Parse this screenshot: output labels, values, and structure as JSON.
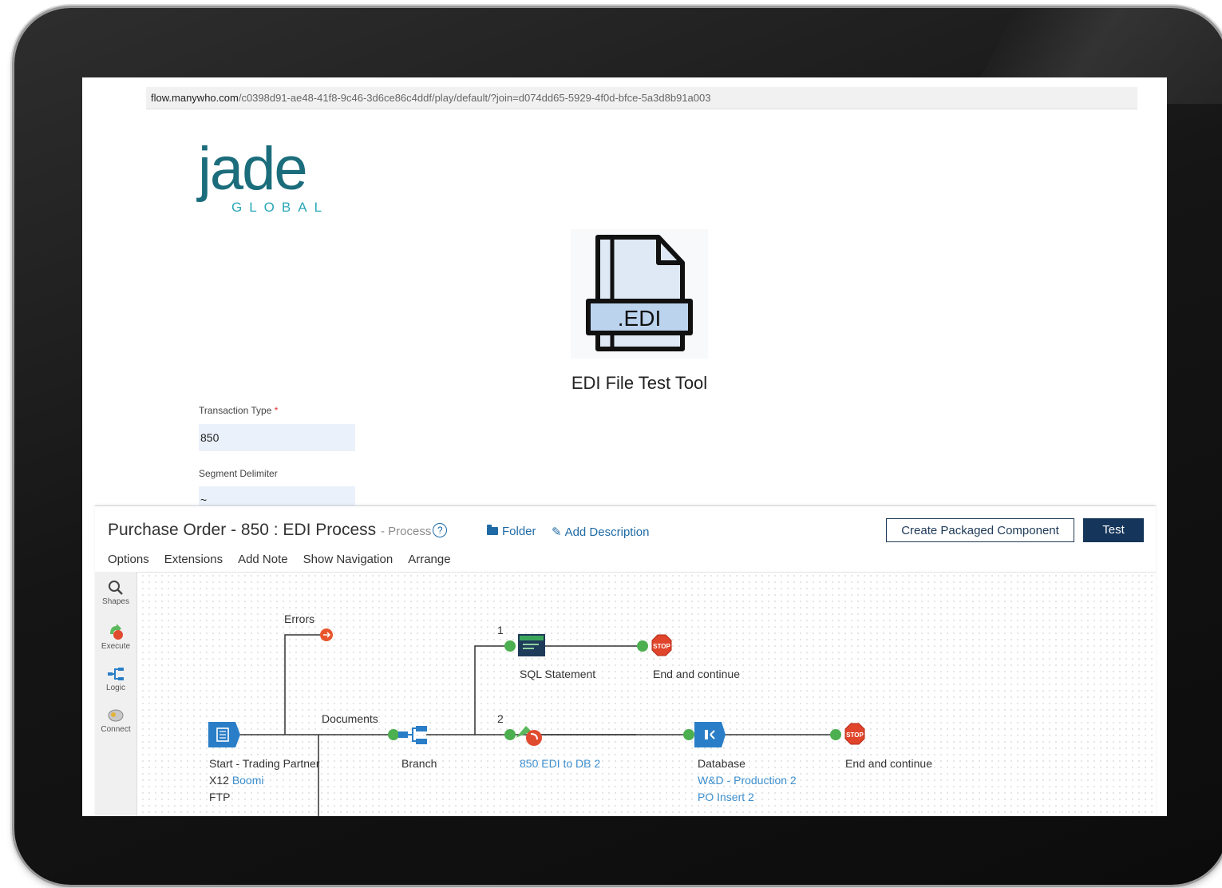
{
  "browser": {
    "url_domain": "flow.manywho.com",
    "url_path": "/c0398d91-ae48-41f8-9c46-3d6ce86c4ddf/play/default/?join=d074dd65-5929-4f0d-bfce-5a3d8b91a003"
  },
  "logo": {
    "main": "jade",
    "sub": "GLOBAL"
  },
  "tool": {
    "icon_text": ".EDI",
    "title": "EDI File Test Tool"
  },
  "form": {
    "transaction_type_label": "Transaction Type",
    "required_mark": "*",
    "transaction_type_value": "850",
    "segment_delimiter_label": "Segment Delimiter",
    "segment_delimiter_value": "~"
  },
  "process": {
    "title": "Purchase Order - 850 : EDI Process",
    "subtitle": "- Process",
    "help": "?",
    "folder_label": "Folder",
    "add_description_label": "Add Description",
    "create_packaged_label": "Create Packaged Component",
    "test_label": "Test",
    "menu": [
      "Options",
      "Extensions",
      "Add Note",
      "Show Navigation",
      "Arrange"
    ],
    "tools": [
      "Shapes",
      "Execute",
      "Logic",
      "Connect"
    ],
    "labels": {
      "errors": "Errors",
      "documents": "Documents",
      "branch_1": "1",
      "branch_2": "2",
      "start_line1": "Start - Trading Partner",
      "start_line2_prefix": "X12",
      "start_line2_link": "Boomi",
      "start_line3": "FTP",
      "branch": "Branch",
      "sql_statement": "SQL Statement",
      "end_continue_1": "End and continue",
      "map_link": "850 EDI to DB 2",
      "database": "Database",
      "db_link1": "W&D - Production 2",
      "db_link2": "PO Insert 2",
      "end_continue_2": "End and continue",
      "stop_text": "STOP"
    }
  },
  "colors": {
    "accent_blue": "#1f6aa5",
    "link_blue": "#3d8fce",
    "teal_logo": "#1b6d7c",
    "stop_red": "#e0442a",
    "connector_green": "#4caf50"
  }
}
